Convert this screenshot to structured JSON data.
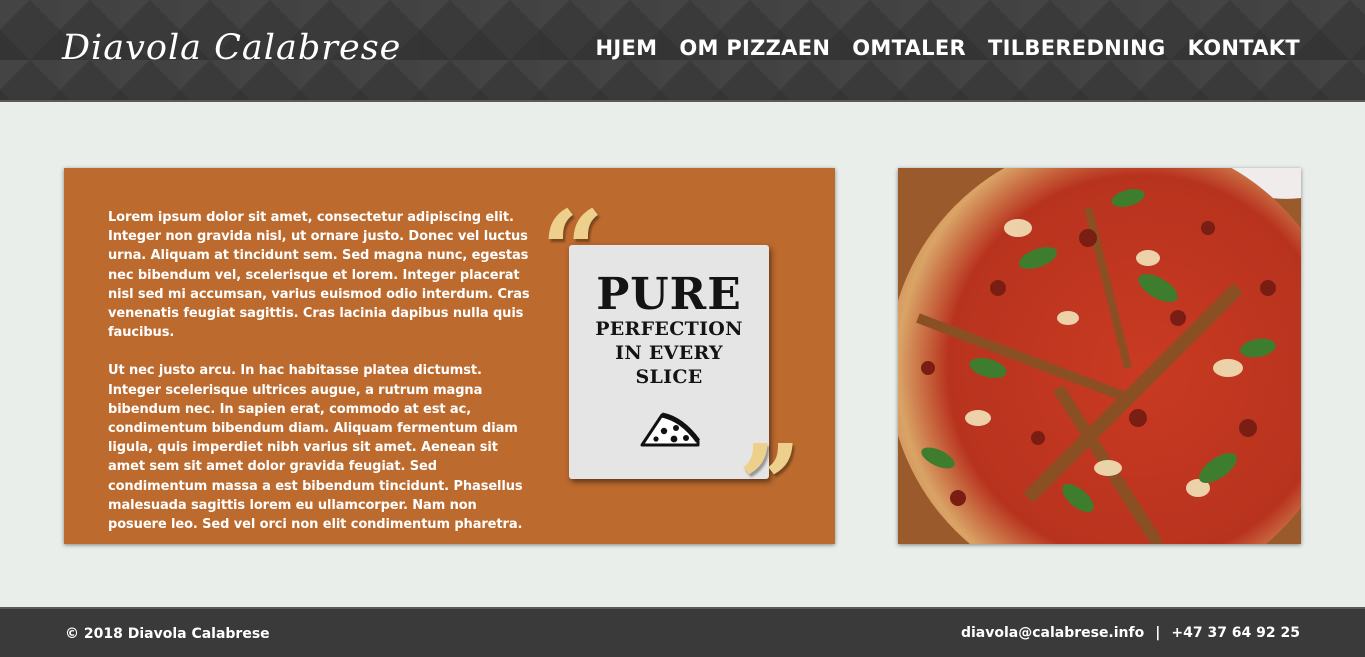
{
  "header": {
    "logo": "Diavola Calabrese",
    "nav": [
      "HJEM",
      "OM PIZZAEN",
      "OMTALER",
      "TILBEREDNING",
      "KONTAKT"
    ]
  },
  "main": {
    "paragraphs": [
      "Lorem ipsum dolor sit amet, consectetur adipiscing elit. Integer non gravida nisl, ut ornare justo. Donec vel luctus urna. Aliquam at tincidunt sem. Sed magna nunc, egestas nec bibendum vel, scelerisque et lorem. Integer placerat nisl sed mi accumsan, varius euismod odio interdum. Cras venenatis feugiat sagittis. Cras lacinia dapibus nulla quis faucibus.",
      "Ut nec justo arcu. In hac habitasse platea dictumst. Integer scelerisque ultrices augue, a rutrum magna bibendum nec. In sapien erat, commodo at est ac, condimentum bibendum diam. Aliquam fermentum diam ligula, quis imperdiet nibh varius sit amet. Aenean sit amet sem sit amet dolor gravida feugiat. Sed condimentum massa a est bibendum tincidunt. Phasellus malesuada sagittis lorem eu ullamcorper. Nam non posuere leo. Sed vel orci non elit condimentum pharetra."
    ],
    "quote": {
      "open_mark": "“",
      "close_mark": "”",
      "big": "PURE",
      "lines": [
        "PERFECTION",
        "IN EVERY",
        "SLICE"
      ],
      "icon": "pizza-slice-icon"
    },
    "photo": "pizza-photo"
  },
  "footer": {
    "copyright": "© 2018 Diavola Calabrese",
    "email": "diavola@calabrese.info",
    "separator": "|",
    "phone": "+47 37 64 92 25"
  },
  "colors": {
    "header_bg": "#3a3a3a",
    "page_bg": "#e9eeeb",
    "card_bg": "#bc6a2e",
    "quote_marks": "#edd08c",
    "quote_box": "#e5e5e5"
  }
}
